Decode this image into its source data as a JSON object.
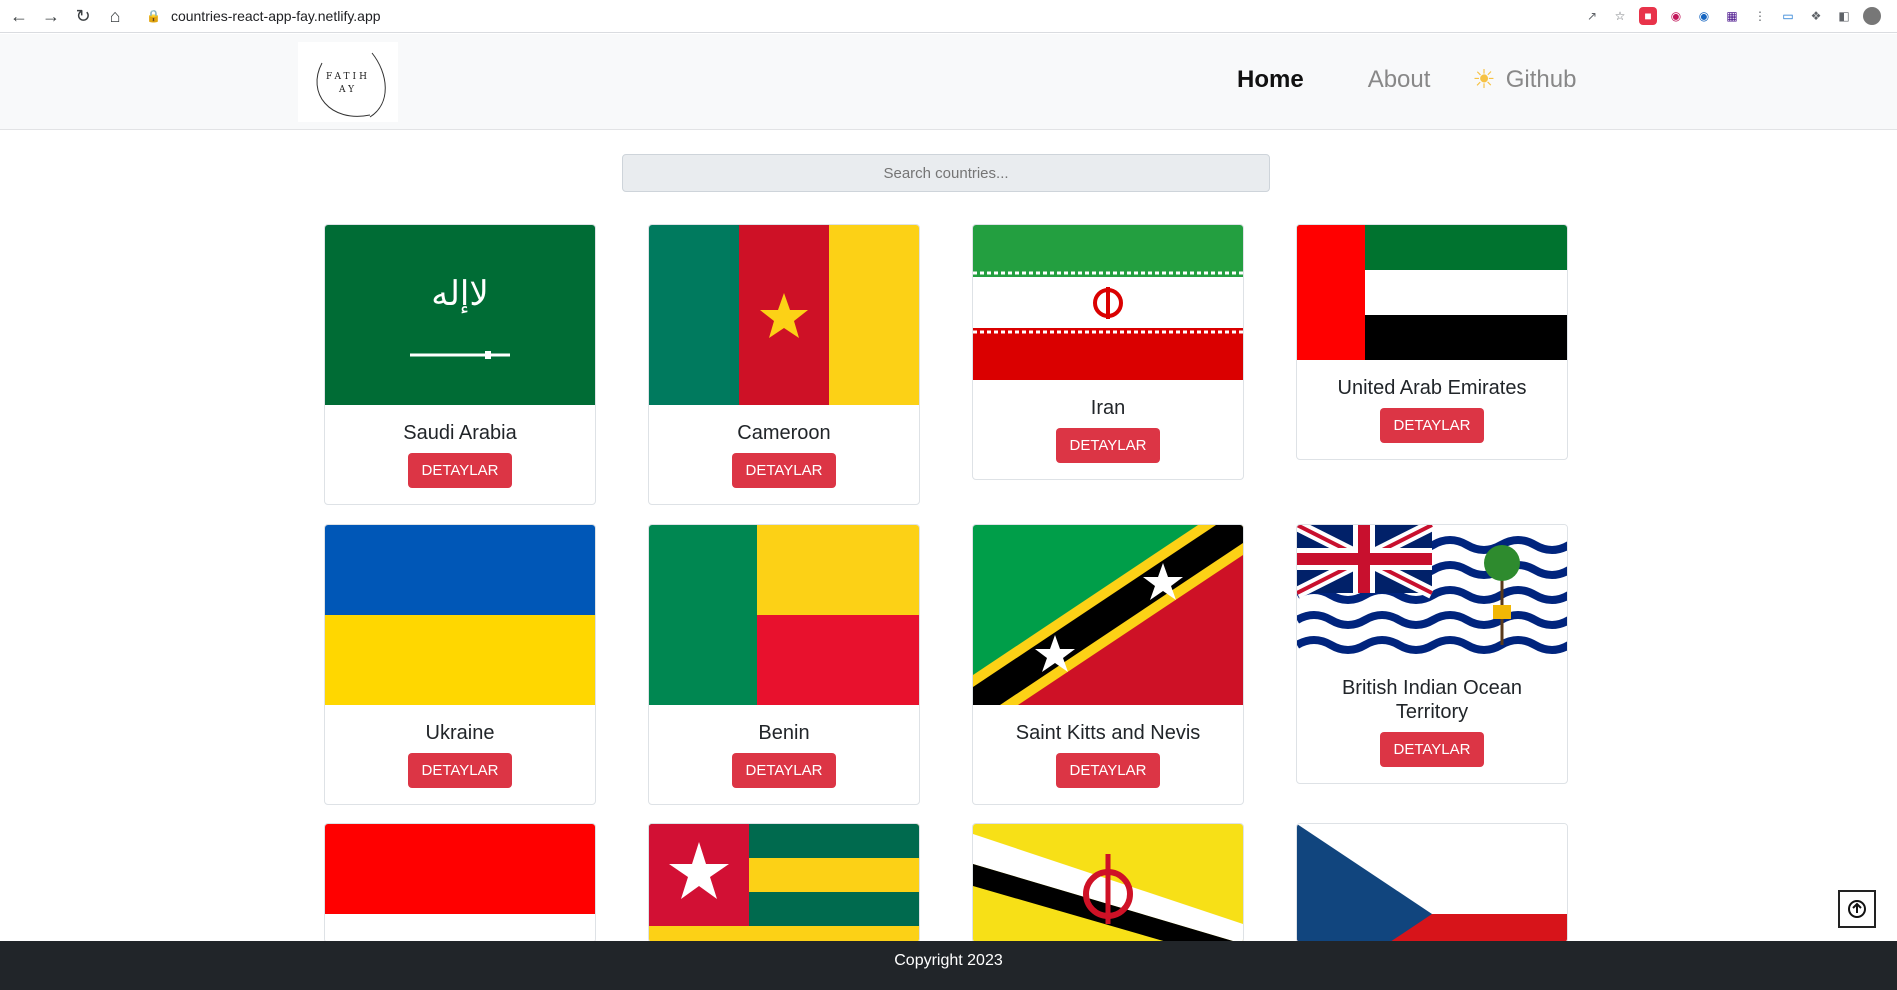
{
  "browser": {
    "url": "countries-react-app-fay.netlify.app"
  },
  "header": {
    "logo_text": "FATIH AY",
    "nav": {
      "home": "Home",
      "about": "About",
      "github": "Github"
    }
  },
  "search": {
    "placeholder": "Search countries..."
  },
  "cards": [
    {
      "name": "Saudi Arabia",
      "button": "DETAYLAR"
    },
    {
      "name": "Cameroon",
      "button": "DETAYLAR"
    },
    {
      "name": "Iran",
      "button": "DETAYLAR"
    },
    {
      "name": "United Arab Emirates",
      "button": "DETAYLAR"
    },
    {
      "name": "Ukraine",
      "button": "DETAYLAR"
    },
    {
      "name": "Benin",
      "button": "DETAYLAR"
    },
    {
      "name": "Saint Kitts and Nevis",
      "button": "DETAYLAR"
    },
    {
      "name": "British Indian Ocean Territory",
      "button": "DETAYLAR"
    }
  ],
  "footer": {
    "copyright": "Copyright 2023"
  }
}
